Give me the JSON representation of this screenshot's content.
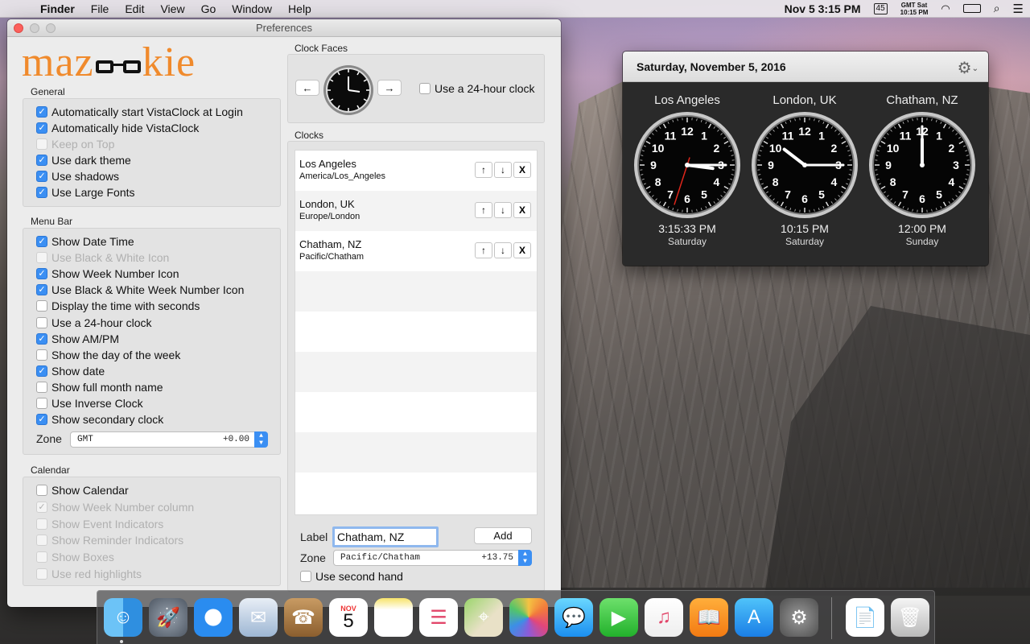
{
  "menubar": {
    "app": "Finder",
    "items": [
      "File",
      "Edit",
      "View",
      "Go",
      "Window",
      "Help"
    ],
    "clock": "Nov 5  3:15 PM",
    "week_number": "45",
    "gmt_label": "GMT Sat",
    "gmt_time": "10:15 PM"
  },
  "prefs": {
    "title": "Preferences",
    "logo": "mazookie",
    "general": {
      "title": "General",
      "items": [
        {
          "label": "Automatically start VistaClock at Login",
          "checked": true,
          "enabled": true
        },
        {
          "label": "Automatically hide VistaClock",
          "checked": true,
          "enabled": true
        },
        {
          "label": "Keep on Top",
          "checked": false,
          "enabled": false
        },
        {
          "label": "Use dark theme",
          "checked": true,
          "enabled": true
        },
        {
          "label": "Use shadows",
          "checked": true,
          "enabled": true
        },
        {
          "label": "Use Large Fonts",
          "checked": true,
          "enabled": true
        }
      ]
    },
    "menubar_section": {
      "title": "Menu Bar",
      "items": [
        {
          "label": "Show Date Time",
          "checked": true,
          "enabled": true
        },
        {
          "label": "Use Black & White Icon",
          "checked": false,
          "enabled": false
        },
        {
          "label": "Show Week Number Icon",
          "checked": true,
          "enabled": true
        },
        {
          "label": "Use Black & White Week Number Icon",
          "checked": true,
          "enabled": true
        },
        {
          "label": "Display the time with seconds",
          "checked": false,
          "enabled": true
        },
        {
          "label": "Use a 24-hour clock",
          "checked": false,
          "enabled": true
        },
        {
          "label": "Show AM/PM",
          "checked": true,
          "enabled": true
        },
        {
          "label": "Show the day of the week",
          "checked": false,
          "enabled": true
        },
        {
          "label": "Show date",
          "checked": true,
          "enabled": true
        },
        {
          "label": "Show full month name",
          "checked": false,
          "enabled": true
        },
        {
          "label": "Use Inverse Clock",
          "checked": false,
          "enabled": true
        },
        {
          "label": "Show secondary clock",
          "checked": true,
          "enabled": true
        }
      ],
      "zone_label": "Zone",
      "zone_value": "GMT",
      "zone_offset": "+0.00"
    },
    "calendar": {
      "title": "Calendar",
      "items": [
        {
          "label": "Show Calendar",
          "checked": false,
          "enabled": true
        },
        {
          "label": "Show Week Number column",
          "checked": true,
          "enabled": false
        },
        {
          "label": "Show Event Indicators",
          "checked": false,
          "enabled": false
        },
        {
          "label": "Show Reminder Indicators",
          "checked": false,
          "enabled": false
        },
        {
          "label": "Show Boxes",
          "checked": false,
          "enabled": false
        },
        {
          "label": "Use red highlights",
          "checked": false,
          "enabled": false
        }
      ]
    },
    "clock_faces": {
      "title": "Clock Faces",
      "prev": "←",
      "next": "→",
      "use24_label": "Use a 24-hour clock"
    },
    "clocks": {
      "title": "Clocks",
      "rows": [
        {
          "name": "Los Angeles",
          "tz": "America/Los_Angeles"
        },
        {
          "name": "London, UK",
          "tz": "Europe/London"
        },
        {
          "name": "Chatham, NZ",
          "tz": "Pacific/Chatham"
        }
      ],
      "up": "↑",
      "down": "↓",
      "remove": "X",
      "label_caption": "Label",
      "label_value": "Chatham, NZ",
      "add": "Add",
      "zone_caption": "Zone",
      "zone_value": "Pacific/Chatham",
      "zone_offset": "+13.75",
      "second_hand_label": "Use second hand"
    }
  },
  "panel": {
    "date": "Saturday, November 5, 2016",
    "clocks": [
      {
        "city": "Los Angeles",
        "time": "3:15:33 PM",
        "day": "Saturday",
        "hour": 3,
        "minute": 15,
        "second": 33
      },
      {
        "city": "London, UK",
        "time": "10:15 PM",
        "day": "Saturday",
        "hour": 10,
        "minute": 15
      },
      {
        "city": "Chatham, NZ",
        "time": "12:00 PM",
        "day": "Sunday",
        "hour": 12,
        "minute": 0
      }
    ]
  },
  "dock": {
    "apps": [
      "finder-icon",
      "launchpad-icon",
      "safari-icon",
      "mail-icon",
      "contacts-icon",
      "calendar-icon",
      "notes-icon",
      "reminders-icon",
      "maps-icon",
      "photos-icon",
      "messages-icon",
      "facetime-icon",
      "itunes-icon",
      "ibooks-icon",
      "app-store-icon",
      "system-preferences-icon",
      "document-icon",
      "trash-icon"
    ],
    "calendar_month": "NOV",
    "calendar_day": "5"
  },
  "colors": {
    "accent": "#3b8ff3",
    "logo": "#f08a2c",
    "close": "#fc605c"
  }
}
